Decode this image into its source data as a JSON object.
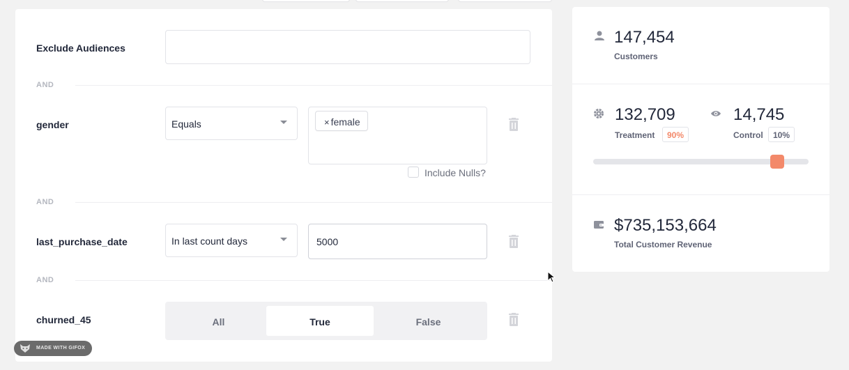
{
  "filters": {
    "exclude": {
      "label": "Exclude Audiences",
      "value": ""
    },
    "and_label": "AND",
    "gender": {
      "label": "gender",
      "operator": "Equals",
      "tag": "female",
      "tag_remove": "×",
      "include_nulls": "Include Nulls?"
    },
    "last_purchase": {
      "label": "last_purchase_date",
      "operator": "In last count days",
      "value": "5000"
    },
    "churned": {
      "label": "churned_45",
      "options": [
        "All",
        "True",
        "False"
      ],
      "selected": "True"
    }
  },
  "summary": {
    "customers": {
      "value": "147,454",
      "label": "Customers",
      "icon": "user-icon"
    },
    "treatment": {
      "value": "132,709",
      "label": "Treatment",
      "pct": "90%",
      "icon": "gear-icon"
    },
    "control": {
      "value": "14,745",
      "label": "Control",
      "pct": "10%",
      "icon": "eye-icon"
    },
    "split_fraction": 0.88,
    "revenue": {
      "value": "$735,153,664",
      "label": "Total Customer Revenue",
      "icon": "wallet-icon"
    }
  },
  "watermark": "MADE WITH GIFOX",
  "colors": {
    "accent": "#f3896a",
    "treatment_pct": "#f3896a",
    "control_pct": "#5f6375"
  }
}
